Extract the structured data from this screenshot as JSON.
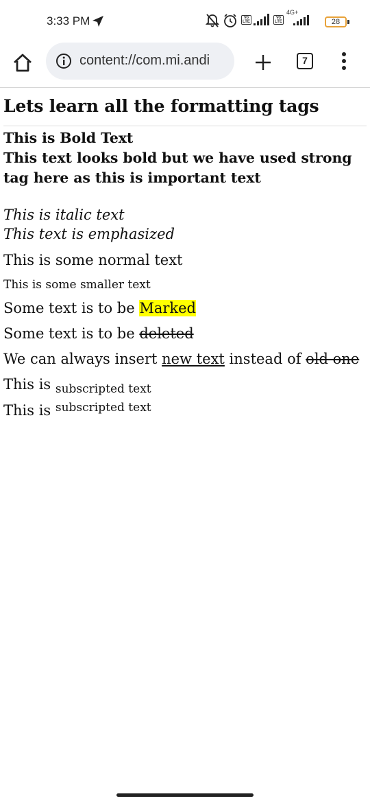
{
  "status_bar": {
    "time": "3:33 PM",
    "lte1": "Vo LTE",
    "lte2": "Vo LTE",
    "network": "4G+",
    "battery": "28"
  },
  "toolbar": {
    "url": "content://com.mi.andi",
    "tab_count": "7"
  },
  "page": {
    "heading": "Lets learn all the formatting tags",
    "bold_text": "This is Bold Text",
    "strong_text": "This text looks bold but we have used strong tag here as this is important text",
    "italic_text": "This is italic text",
    "emphasized_text": "This text is emphasized",
    "normal_text": "This is some normal text",
    "small_text": "This is some smaller text",
    "marked_prefix": "Some text is to be ",
    "marked_word": "Marked",
    "deleted_prefix": "Some text is to be ",
    "deleted_word": "deleted",
    "insert_prefix": "We can always insert ",
    "inserted_text": "new text",
    "insert_middle": " instead of ",
    "old_text": "old one",
    "sub_prefix": "This is ",
    "sub_text": "subscripted text",
    "sup_prefix": "This is ",
    "sup_text": "subscripted text"
  }
}
